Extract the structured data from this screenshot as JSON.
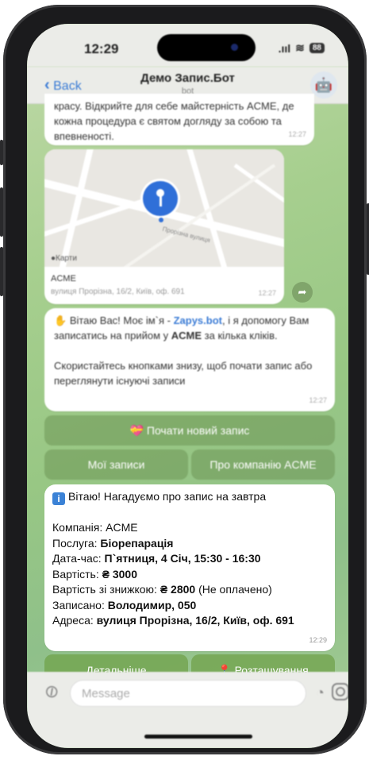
{
  "status": {
    "time": "12:29",
    "signal": ".ııl",
    "wifi": "≋",
    "battery": "88"
  },
  "nav": {
    "back": "Back",
    "title": "Демо Запис.Бот",
    "subtitle": "bot"
  },
  "messages": {
    "intro_tail": {
      "text": "красу. Відкрийте для себе майстерність ACME, де кожна процедура є святом догляду за собою та впевненості.",
      "time": "12:27"
    },
    "location": {
      "map_label": "Карти",
      "street": "Прорізна вулиця",
      "name": "ACME",
      "address": "вулиця Прорізна, 16/2, Київ, оф. 691",
      "time": "12:27"
    },
    "greeting": {
      "icon": "✋",
      "l1a": "Вітаю Вас! Моє ім`я - ",
      "link": "Zapys.bot",
      "l1b": ", і я допомогу Вам записатись на прийом у ",
      "company": "ACME",
      "l1c": " за кілька кліків.",
      "l2": "Скористайтесь кнопками знизу, щоб почати запис або переглянути існуючі записи",
      "time": "12:27"
    },
    "reminder": {
      "icon": "i",
      "head": "Вітаю! Нагадуємо про запис на завтра",
      "company_label": "Компанія: ",
      "company_value": "ACME",
      "service_label": "Послуга: ",
      "service_value": "Біорепарація",
      "datetime_label": "Дата-час: ",
      "datetime_value": "П`ятниця, 4 Січ, 15:30 - 16:30",
      "price_label": "Вартість: ",
      "price_value": "₴ 3000",
      "discount_label": "Вартість зі знижкою: ",
      "discount_value": "₴ 2800",
      "discount_note": " (Не оплачено)",
      "recorded_label": "Записано: ",
      "recorded_value": "Володимир, 050",
      "address_label": "Адреса: ",
      "address_value": "вулиця Прорізна, 16/2, Київ, оф. 691",
      "time": "12:29"
    }
  },
  "keyboard1": {
    "new_record": "💝 Почати новий запис",
    "my_records": "Мої записи",
    "about": "Про компанію ACME"
  },
  "keyboard2": {
    "details": "Детальніше",
    "location": "📍 Розташування"
  },
  "input": {
    "placeholder": "Message"
  },
  "colors": {
    "accent": "#3a7bd5",
    "link": "#3a7bd5",
    "pin": "#2f6fd8"
  }
}
